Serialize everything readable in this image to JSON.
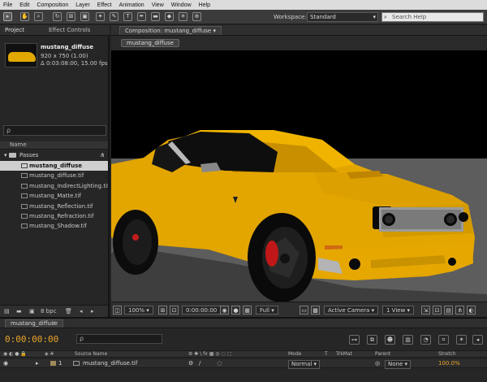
{
  "menu": [
    "File",
    "Edit",
    "Composition",
    "Layer",
    "Effect",
    "Animation",
    "View",
    "Window",
    "Help"
  ],
  "toolbar": {
    "tools": [
      "▸",
      "✋",
      "🔍",
      "↻",
      "⊞",
      "▣",
      "✦",
      "✎",
      "⊥",
      "T",
      "✒",
      "▬",
      "◆",
      "✳",
      "⊕"
    ],
    "workspace_label": "Workspace:",
    "workspace_value": "Standard",
    "search_placeholder": "Search Help"
  },
  "project": {
    "tabs": [
      "Project",
      "Effect Controls"
    ],
    "selected_file": "mustang_diffuse",
    "file_dims": "920 x 750 (1.00)",
    "file_duration": "Δ 0:03:08:00, 15.00 fps",
    "search_placeholder": "ρ",
    "column_name": "Name",
    "folder_name": "Passes",
    "files": [
      "mustang_diffuse",
      "mustang_diffuse.tif",
      "mustang_IndirectLighting.tif",
      "mustang_Matte.tif",
      "mustang_Reflection.tif",
      "mustang_Refraction.tif",
      "mustang_Shadow.tif"
    ],
    "bpc": "8 bpc"
  },
  "composition": {
    "tab_label": "Composition: mustang_diffuse",
    "pill_label": "mustang_diffuse",
    "zoom": "100%",
    "timecode": "0:00:00:00",
    "resolution": "Full",
    "camera": "Active Camera",
    "views": "1 View"
  },
  "timeline": {
    "tab_label": "mustang_diffuse",
    "timecode": "0:00:00:00",
    "search_placeholder": "ρ",
    "columns": {
      "source_name": "Source Name",
      "mode": "Mode",
      "t": "T",
      "trkmat": "TrkMat",
      "parent": "Parent",
      "stretch": "Stretch"
    },
    "layer": {
      "number": "1",
      "name": "mustang_diffuse.tif",
      "mode": "Normal",
      "parent": "None",
      "stretch": "100.0%"
    }
  }
}
